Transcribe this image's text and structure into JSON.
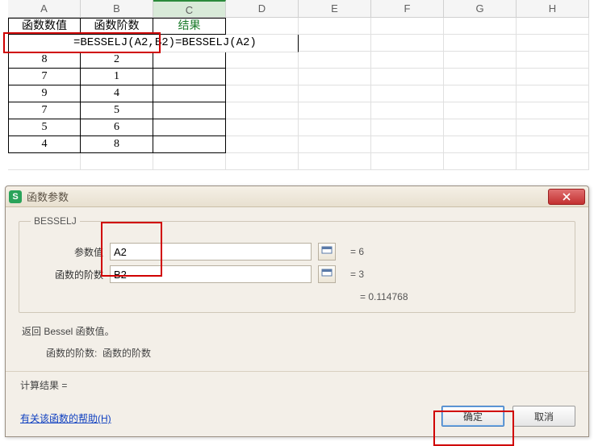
{
  "columns": [
    "A",
    "B",
    "C",
    "D",
    "E",
    "F",
    "G",
    "H"
  ],
  "headers": {
    "a": "函数数值",
    "b": "函数阶数",
    "c": "结果"
  },
  "formula_overlay": "=BESSELJ(A2,B2)=BESSELJ(A2)",
  "rows": [
    {
      "a": "8",
      "b": "2"
    },
    {
      "a": "7",
      "b": "1"
    },
    {
      "a": "9",
      "b": "4"
    },
    {
      "a": "7",
      "b": "5"
    },
    {
      "a": "5",
      "b": "6"
    },
    {
      "a": "4",
      "b": "8"
    }
  ],
  "dialog": {
    "title": "函数参数",
    "function_name": "BESSELJ",
    "params": [
      {
        "label": "参数值",
        "value": "A2",
        "eval": "= 6"
      },
      {
        "label": "函数的阶数",
        "value": "B2",
        "eval": "= 3"
      }
    ],
    "preview": "= 0.114768",
    "desc": "返回 Bessel 函数值。",
    "desc_sub_label": "函数的阶数:",
    "desc_sub_text": "函数的阶数",
    "calc_result_label": "计算结果 =",
    "help_link": "有关该函数的帮助(H)",
    "ok": "确定",
    "cancel": "取消"
  },
  "chart_data": {
    "type": "table",
    "title": "",
    "columns": [
      "函数数值",
      "函数阶数",
      "结果"
    ],
    "rows": [
      [
        8,
        2,
        null
      ],
      [
        7,
        1,
        null
      ],
      [
        9,
        4,
        null
      ],
      [
        7,
        5,
        null
      ],
      [
        5,
        6,
        null
      ],
      [
        4,
        8,
        null
      ]
    ]
  }
}
